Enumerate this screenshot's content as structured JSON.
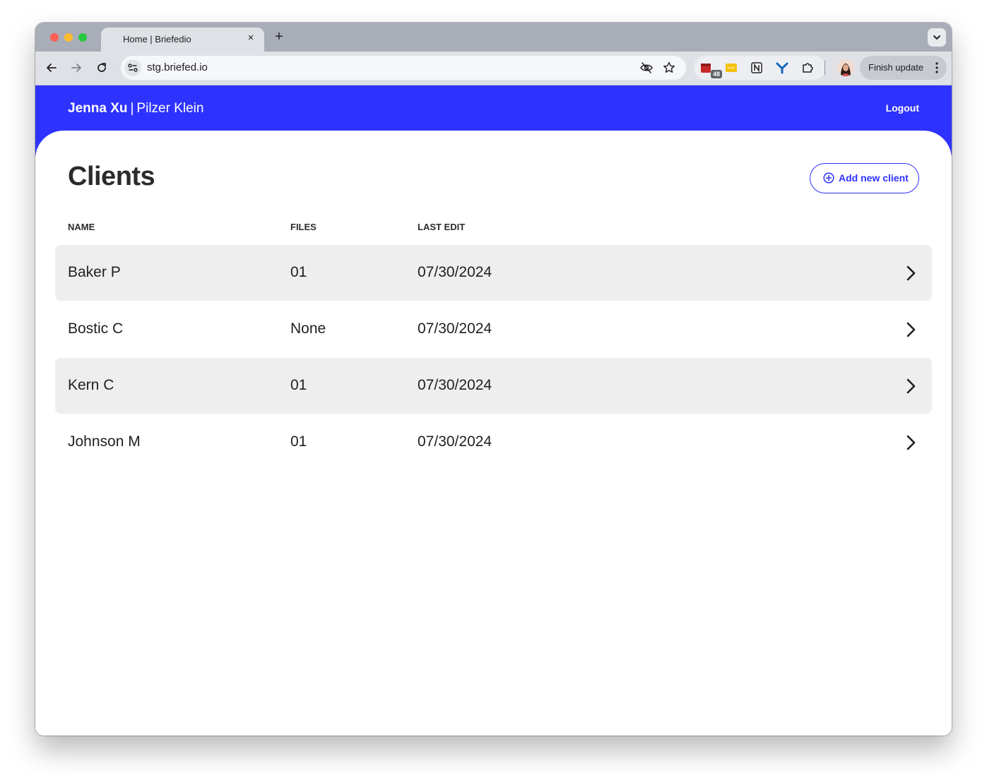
{
  "browser": {
    "tab_title": "Home | Briefedio",
    "tab_close": "×",
    "new_tab": "+",
    "url": "stg.briefed.io",
    "extension_badge": "48",
    "finish_update": "Finish update"
  },
  "app": {
    "user_name": "Jenna Xu",
    "separator": "|",
    "org_name": "Pilzer Klein",
    "logout": "Logout",
    "brand_color": "#2e32ff",
    "page_title": "Clients",
    "add_client": "Add new client"
  },
  "table": {
    "columns": [
      "NAME",
      "FILES",
      "LAST EDIT"
    ],
    "rows": [
      {
        "name": "Baker P",
        "files": "01",
        "last_edit": "07/30/2024"
      },
      {
        "name": "Bostic C",
        "files": "None",
        "last_edit": "07/30/2024"
      },
      {
        "name": "Kern C",
        "files": "01",
        "last_edit": "07/30/2024"
      },
      {
        "name": "Johnson M",
        "files": "01",
        "last_edit": "07/30/2024"
      }
    ]
  }
}
